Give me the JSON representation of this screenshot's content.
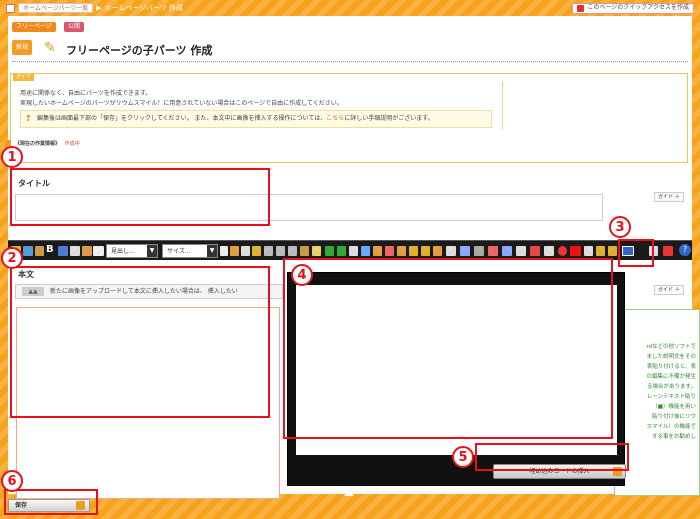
{
  "topbar": {
    "crumb_root": "ホームページパーツ一覧",
    "crumb_current": "ホームページパーツ 作成",
    "crumb_sep": "▶",
    "quick_access": "このページのクイックアクセスを作成"
  },
  "header": {
    "badge_free": "フリーページ",
    "badge_public": "公開",
    "new_badge": "新規",
    "page_title": "フリーページの子パーツ 作成"
  },
  "guide": {
    "tag": "ガイド",
    "line1": "用途に関係なく、自由にパーツを作成できます。",
    "line2": "実現したいホームページのパーツがリウムスマイル！に用意されていない場合はこのページで自由に作成してください。",
    "tip_before": "編集後は画面最下部の「保存」をクリックしてください。 また、本文中に画像を挿入する操作については、",
    "tip_link": "こちら",
    "tip_after": "に詳しい手順説明がございます。"
  },
  "status": {
    "label": "《現在の作業情報》",
    "state": "作成中"
  },
  "title_section": {
    "label": "タイトル",
    "guide_btn": "ガイド ＋"
  },
  "toolbar": {
    "heading_select": "見出し...",
    "size_select": "サイズ...",
    "dropdown_arrow": "▼",
    "bold": "B",
    "help": "?"
  },
  "body_section": {
    "label": "本文",
    "upload_text": "新たに画像をアップロードして本文に挿入したい場合は、 挿入したい",
    "guide_btn": "ガイド ＋"
  },
  "side_help": {
    "lines": [
      "rdなどの他ソフトで",
      "ました説明文をその",
      "表貼り付けると、表",
      "の編集に不備が発生",
      "る場合があります。",
      "レーンテキスト貼り",
      "（■）機能を用い",
      "貼り付け後にリウ",
      "スマイル！の機能で",
      "する事をお勧めし"
    ]
  },
  "overlay": {
    "embed_button": "埋め込みコードの挿入"
  },
  "save_button": "保存",
  "callouts": [
    "1",
    "2",
    "3",
    "4",
    "5",
    "6"
  ],
  "colors": {
    "orange": "#f7a21b",
    "red": "#e8101a",
    "green": "#2e8b2e",
    "toolbar": "#1a1a1a"
  }
}
